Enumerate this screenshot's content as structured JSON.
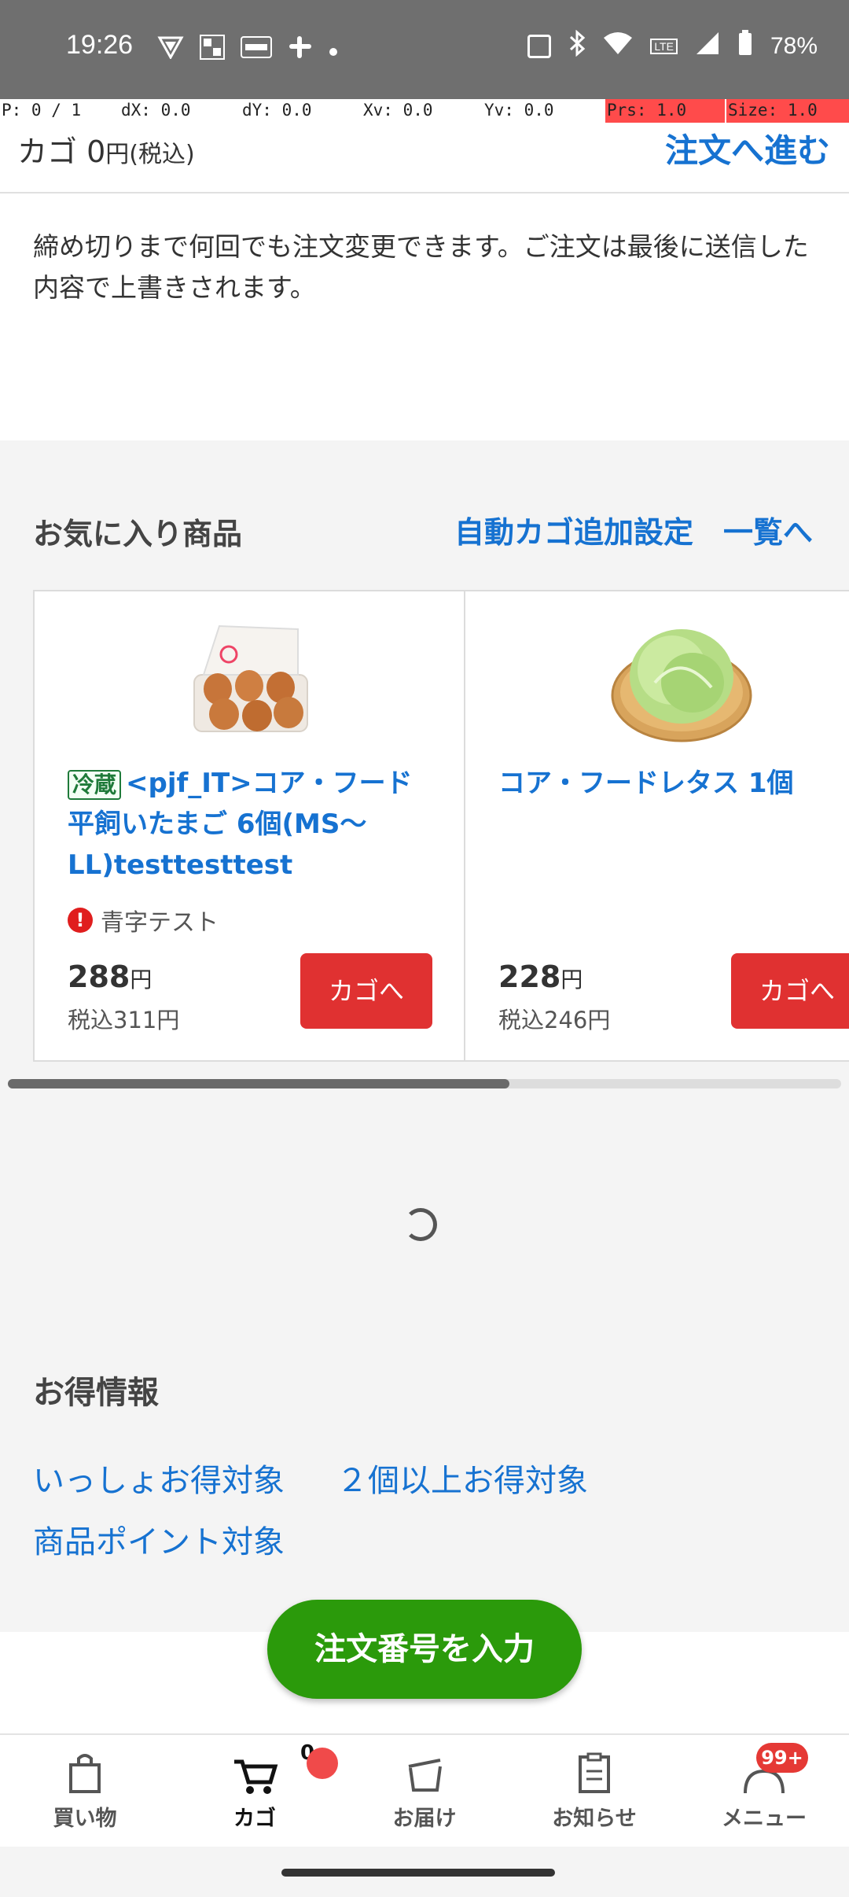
{
  "status_bar": {
    "time": "19:26",
    "battery": "78%",
    "left_icons": [
      "vpn-icon",
      "uniqlo-icon",
      "view-icon",
      "slack-icon",
      "dot-icon"
    ],
    "right_icons": [
      "nfc-icon",
      "bluetooth-icon",
      "wifi-icon",
      "volte-icon",
      "signal-icon",
      "battery-icon"
    ]
  },
  "pointer_overlay": {
    "p": "P: 0 / 1",
    "dx": "dX: 0.0",
    "dy": "dY: 0.0",
    "xv": "Xv: 0.0",
    "yv": "Yv: 0.0",
    "prs": "Prs: 1.0",
    "size": "Size: 1.0"
  },
  "cart_header": {
    "label": "カゴ 0",
    "label_suffix": "円(税込)",
    "proceed": "注文へ進む"
  },
  "notice": "締め切りまで何回でも注文変更できます。ご注文は最後に送信した内容で上書きされます。",
  "favorites": {
    "title": "お気に入り商品",
    "auto_cart_link": "自動カゴ追加設定",
    "list_link": "一覧へ",
    "items": [
      {
        "tag": "冷蔵",
        "name": "<pjf_IT>コア・フード平飼いたまご 6個(MS〜LL)testtesttest",
        "warning": "青字テスト",
        "price": "288",
        "price_unit": "円",
        "tax_included": "税込311円",
        "button": "カゴへ"
      },
      {
        "name": "コア・フードレタス 1個",
        "price": "228",
        "price_unit": "円",
        "tax_included": "税込246円",
        "button": "カゴへ"
      }
    ]
  },
  "deals": {
    "title": "お得情報",
    "links": [
      "いっしょお得対象",
      "２個以上お得対象",
      "商品ポイント対象"
    ]
  },
  "order_number_button": "注文番号を入力",
  "bottom_nav": {
    "items": [
      {
        "label": "買い物",
        "icon": "shopping-bag-icon"
      },
      {
        "label": "カゴ",
        "icon": "cart-icon",
        "count": "0"
      },
      {
        "label": "お届け",
        "icon": "delivery-box-icon"
      },
      {
        "label": "お知らせ",
        "icon": "clipboard-icon"
      },
      {
        "label": "メニュー",
        "icon": "person-icon",
        "badge": "99+"
      }
    ]
  },
  "colors": {
    "link_blue": "#1672d1",
    "add_button_red": "#e03131",
    "order_button_green": "#2b9a0b"
  }
}
